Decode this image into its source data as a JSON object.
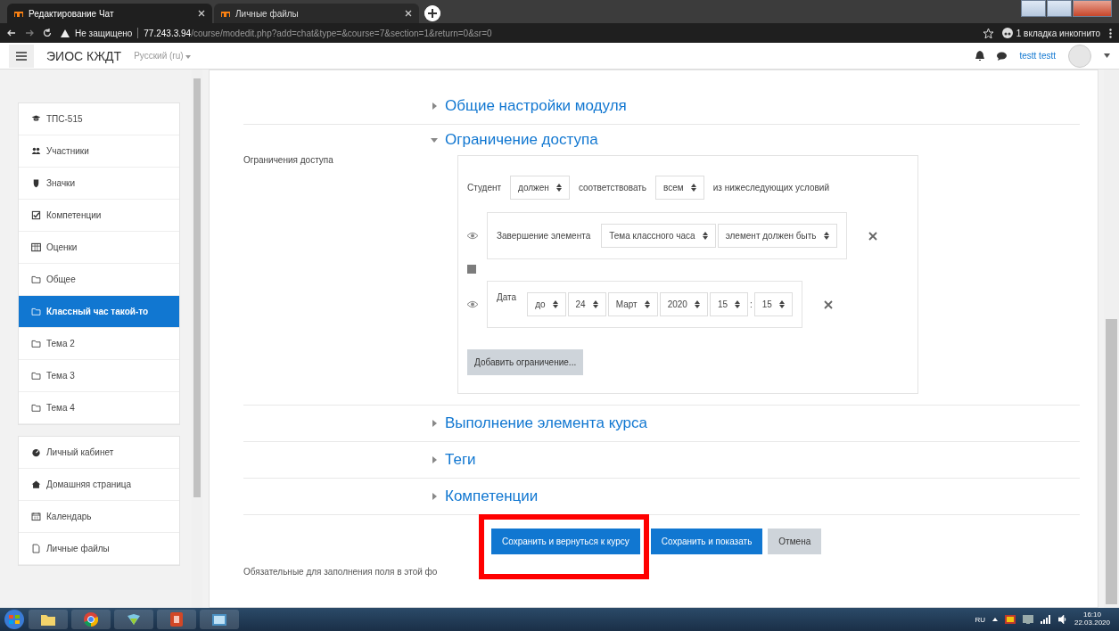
{
  "browser": {
    "tabs": [
      {
        "title": "Редактирование Чат",
        "selected": true
      },
      {
        "title": "Личные файлы",
        "selected": false
      }
    ],
    "security": "Не защищено",
    "url_host": "77.243.3.94",
    "url_path": "/course/modedit.php?add=chat&type=&course=7&section=1&return=0&sr=0",
    "profile": "1 вкладка инкогнито"
  },
  "navbar": {
    "site_name": "ЭИОС КЖДТ",
    "language": "Русский (ru)",
    "user": "testt testt"
  },
  "sidebar": {
    "groups": [
      {
        "items": [
          {
            "kind": "course",
            "label": "ТПС-515",
            "selected": false
          },
          {
            "kind": "participants",
            "label": "Участники",
            "selected": false
          },
          {
            "kind": "badges",
            "label": "Значки",
            "selected": false
          },
          {
            "kind": "competencies",
            "label": "Компетенции",
            "selected": false
          },
          {
            "kind": "grades",
            "label": "Оценки",
            "selected": false
          },
          {
            "kind": "section",
            "label": "Общее",
            "selected": false
          },
          {
            "kind": "section",
            "label": "Классный час такой-то",
            "selected": true
          },
          {
            "kind": "section",
            "label": "Тема 2",
            "selected": false
          },
          {
            "kind": "section",
            "label": "Тема 3",
            "selected": false
          },
          {
            "kind": "section",
            "label": "Тема 4",
            "selected": false
          }
        ]
      },
      {
        "items": [
          {
            "kind": "dashboard",
            "label": "Личный кабинет",
            "selected": false
          },
          {
            "kind": "home",
            "label": "Домашняя страница",
            "selected": false
          },
          {
            "kind": "calendar",
            "label": "Календарь",
            "selected": false
          },
          {
            "kind": "files",
            "label": "Личные файлы",
            "selected": false
          }
        ]
      }
    ]
  },
  "sections": [
    {
      "title": "Общие настройки модуля",
      "expanded": false
    },
    {
      "title": "Ограничение доступа",
      "expanded": true
    },
    {
      "title": "Выполнение элемента курса",
      "expanded": false
    },
    {
      "title": "Теги",
      "expanded": false
    },
    {
      "title": "Компетенции",
      "expanded": false
    }
  ],
  "restrictions": {
    "label": "Ограничения доступа",
    "header": [
      {
        "kind": "text",
        "text": "Студент"
      },
      {
        "kind": "select",
        "value": "должен"
      },
      {
        "kind": "text",
        "text": "соответствовать"
      },
      {
        "kind": "select",
        "value": "всем"
      },
      {
        "kind": "text",
        "text": "из нижеследующих условий"
      }
    ],
    "conditions": [
      {
        "kind": "completion",
        "label": "Завершение элемента",
        "fields": [
          {
            "kind": "select",
            "value": "Тема классного часа"
          },
          {
            "kind": "select",
            "value": "элемент должен быть"
          }
        ]
      },
      {
        "kind": "date",
        "label": "Дата",
        "fields": [
          {
            "kind": "select",
            "value": "до"
          },
          {
            "kind": "select",
            "value": "24"
          },
          {
            "kind": "select",
            "value": "Март"
          },
          {
            "kind": "select",
            "value": "2020"
          },
          {
            "kind": "select",
            "value": "15"
          },
          {
            "kind": "text",
            "text": ":"
          },
          {
            "kind": "select",
            "value": "15"
          }
        ]
      }
    ],
    "add_button": "Добавить ограничение..."
  },
  "buttons": [
    {
      "label": "Сохранить и вернуться к курсу",
      "kind": "primary"
    },
    {
      "label": "Сохранить и показать",
      "kind": "primary"
    },
    {
      "label": "Отмена",
      "kind": "secondary"
    }
  ],
  "footnote": "Обязательные для заполнения поля в этой фо",
  "taskbar": {
    "language": "RU",
    "time": "16:10",
    "date": "22.03.2020"
  }
}
